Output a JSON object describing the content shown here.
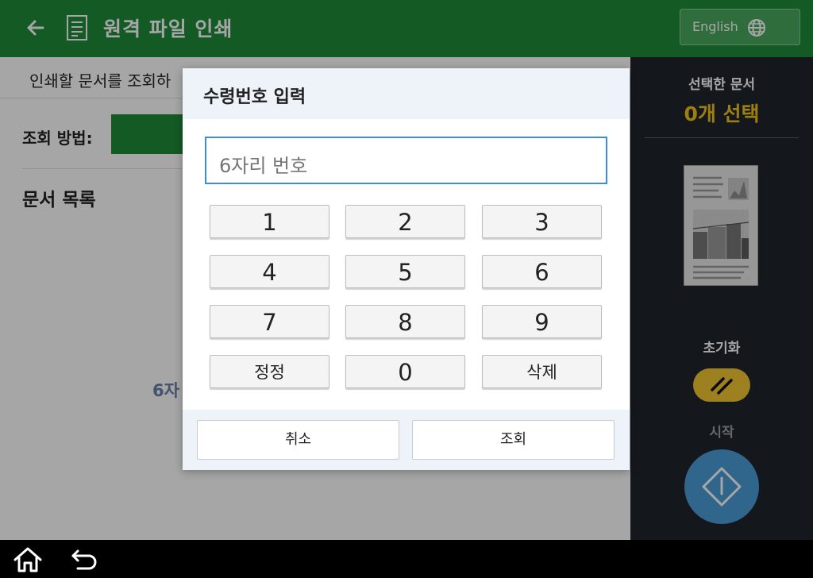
{
  "header": {
    "title": "원격 파일 인쇄",
    "language_label": "English"
  },
  "main": {
    "subtitle": "인쇄할 문서를 조회하",
    "search_method_label": "조회 방법:",
    "doc_list_title": "문서 목록",
    "hint_text": "6자"
  },
  "right_panel": {
    "selected_label": "선택한 문서",
    "selected_count": "0개 선택",
    "reset_label": "초기화",
    "start_label": "시작"
  },
  "dialog": {
    "title": "수령번호 입력",
    "input_placeholder": "6자리 번호",
    "keys": [
      "1",
      "2",
      "3",
      "4",
      "5",
      "6",
      "7",
      "8",
      "9",
      "정정",
      "0",
      "삭제"
    ],
    "cancel_label": "취소",
    "confirm_label": "조회"
  },
  "colors": {
    "header_green": "#1f8b3a",
    "panel_dark": "#20242c",
    "accent_yellow": "#f0c419",
    "start_blue": "#4b9bd8",
    "input_border_blue": "#3a8fd8"
  },
  "icons": {
    "back": "arrow-left-icon",
    "document": "document-icon",
    "globe": "globe-icon",
    "reset": "reset-slash-icon",
    "start": "start-diamond-icon",
    "home": "home-icon",
    "undo": "undo-arrow-icon"
  }
}
